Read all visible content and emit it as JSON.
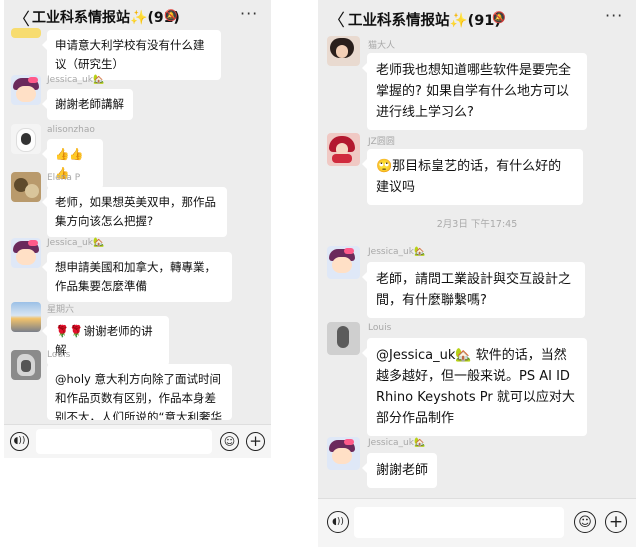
{
  "group_title": "工业科系情报站",
  "member_count": "(91)",
  "back_glyph": "〈",
  "more_glyph": "···",
  "sparkle_glyph": "✨",
  "voice_icon": "voice-icon",
  "emoji_icon": "emoji-icon",
  "plus_icon": "plus-icon",
  "left_messages": [
    {
      "name": "",
      "text": "申请意大利学校有没有什么建议（研究生）"
    },
    {
      "name": "Jessica_uk🏡",
      "text": "謝謝老師講解"
    },
    {
      "name": "alisonzhao",
      "text": "👍👍👍"
    },
    {
      "name": "Elena P",
      "text": "老师，如果想英美双申，那作品集方向该怎么把握?"
    },
    {
      "name": "Jessica_uk🏡",
      "text": "想申請美國和加拿大，轉專業，作品集要怎麼準備"
    },
    {
      "name": "星期六",
      "text": "🌹🌹谢谢老师的讲解"
    },
    {
      "name": "Louis",
      "text": "@holy 意大利方向除了面试时间和作品页数有区别，作品本身差别不大，人们所说的“意大利奢华风”"
    }
  ],
  "right_messages": [
    {
      "name": "猫大人",
      "text": "老师我也想知道哪些软件是要完全掌握的? 如果自学有什么地方可以进行线上学习么?"
    },
    {
      "name": "JZ圆圆",
      "text": "🙄那目标皇艺的话，有什么好的建议吗"
    },
    {
      "name": "Jessica_uk🏡",
      "text": "老師，請問工業設計與交互設計之間，有什麼聯繫嗎?"
    },
    {
      "name": "Louis",
      "text": "@Jessica_uk🏡 软件的话，当然越多越好，但一般来说。PS AI ID Rhino Keyshots Pr 就可以应对大部分作品制作"
    },
    {
      "name": "Jessica_uk🏡",
      "text": "謝謝老師"
    }
  ],
  "timestamp": "2月3日 下午17:45"
}
